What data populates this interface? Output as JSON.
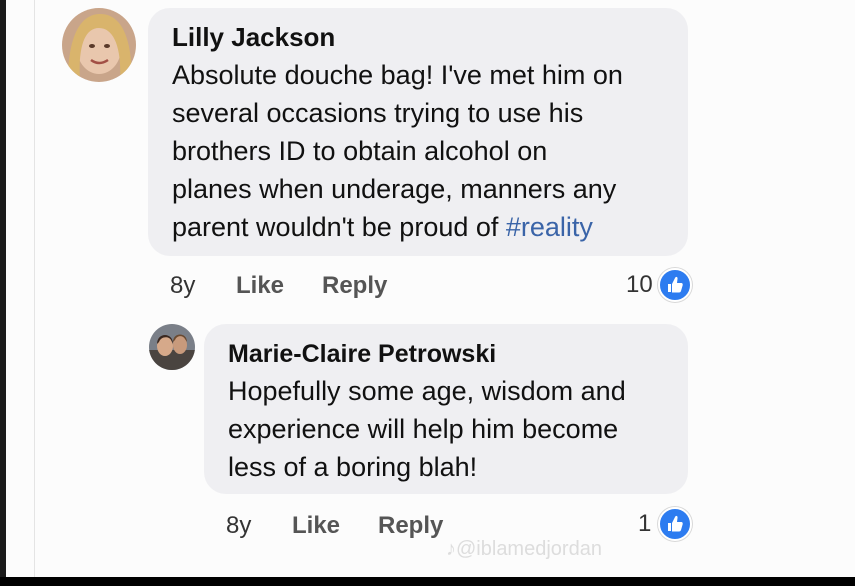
{
  "comments": [
    {
      "author": "Lilly Jackson",
      "lines": [
        "Absolute douche bag! I've met him on",
        "several occasions trying to use his",
        "brothers ID to obtain alcohol on",
        "planes when underage, manners any",
        "parent wouldn't be proud of "
      ],
      "hashtag": "#reality",
      "time": "8y",
      "like_label": "Like",
      "reply_label": "Reply",
      "reaction_count": "10"
    },
    {
      "author": "Marie-Claire Petrowski",
      "lines": [
        "Hopefully some age, wisdom and",
        "experience will help him become",
        "less of a boring blah!"
      ],
      "time": "8y",
      "like_label": "Like",
      "reply_label": "Reply",
      "reaction_count": "1"
    }
  ],
  "watermark": "@iblamedjordan",
  "colors": {
    "hashtag": "#3a64a8",
    "like_badge": "#2d7cf0",
    "bubble": "#efeff2"
  },
  "icons": {
    "reaction": "thumbs-up-icon",
    "watermark_logo": "tiktok-icon"
  }
}
